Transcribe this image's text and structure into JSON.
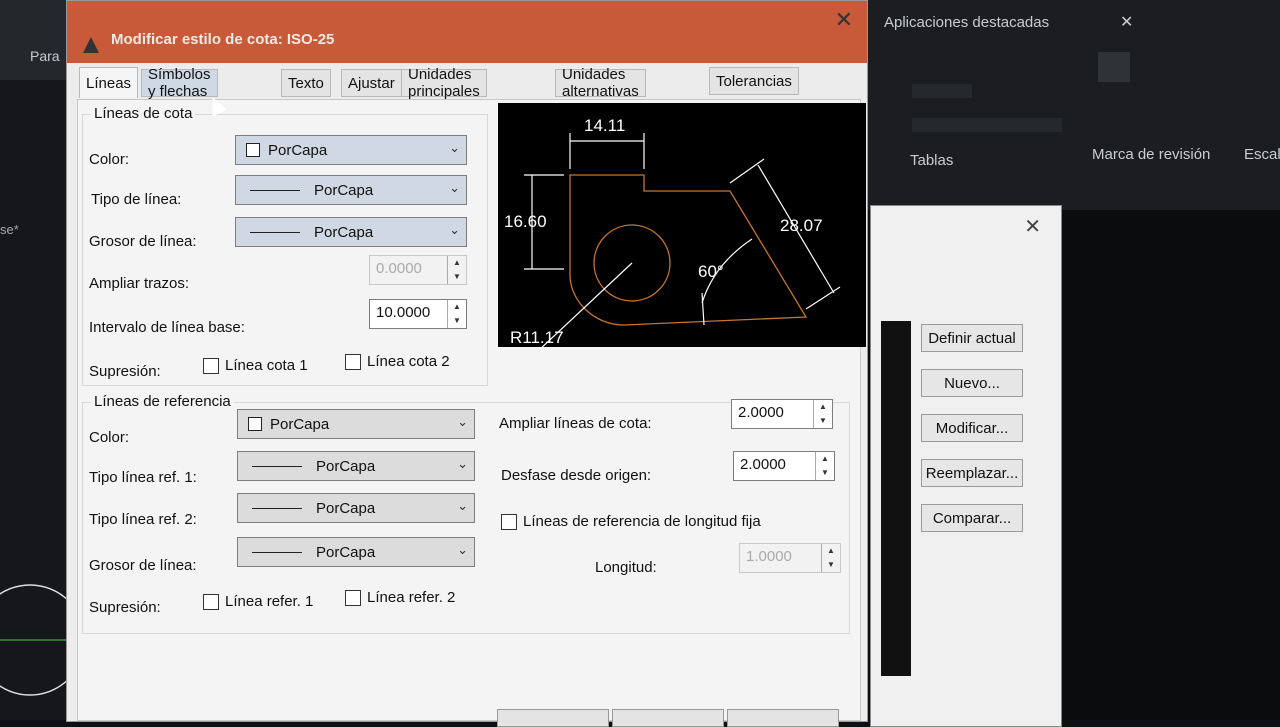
{
  "background": {
    "top_left_text": "Para",
    "ribbon_title": "Aplicaciones destacadas",
    "tables_label": "Tablas",
    "revision_label": "Marca de revisión",
    "scale_label": "Escal",
    "tab_fragment": "se*"
  },
  "secondary_dialog": {
    "buttons": [
      "Definir actual",
      "Nuevo...",
      "Modificar...",
      "Reemplazar...",
      "Comparar..."
    ]
  },
  "dialog": {
    "title": "Modificar estilo de cota: ISO-25",
    "tabs": [
      "Líneas",
      "Símbolos y flechas",
      "Texto",
      "Ajustar",
      "Unidades principales",
      "Unidades alternativas",
      "Tolerancias"
    ],
    "active_tab": "Líneas",
    "dim_lines": {
      "title": "Líneas de cota",
      "color_label": "Color:",
      "color_value": "PorCapa",
      "linetype_label": "Tipo de línea:",
      "linetype_value": "PorCapa",
      "lineweight_label": "Grosor de línea:",
      "lineweight_value": "PorCapa",
      "extend_label": "Ampliar trazos:",
      "extend_value": "0.0000",
      "baseline_label": "Intervalo de línea base:",
      "baseline_value": "10.0000",
      "suppress_label": "Supresión:",
      "suppress_1": "Línea cota 1",
      "suppress_2": "Línea cota 2"
    },
    "ext_lines": {
      "title": "Líneas de referencia",
      "color_label": "Color:",
      "color_value": "PorCapa",
      "linetype1_label": "Tipo línea ref. 1:",
      "linetype1_value": "PorCapa",
      "linetype2_label": "Tipo línea ref. 2:",
      "linetype2_value": "PorCapa",
      "lineweight_label": "Grosor de línea:",
      "lineweight_value": "PorCapa",
      "suppress_label": "Supresión:",
      "suppress_1": "Línea refer. 1",
      "suppress_2": "Línea refer. 2"
    },
    "right": {
      "extend_label": "Ampliar líneas de cota:",
      "extend_value": "2.0000",
      "offset_label": "Desfase desde origen:",
      "offset_value": "2.0000",
      "fixed_label": "Líneas de referencia de longitud fija",
      "length_label": "Longitud:",
      "length_value": "1.0000"
    },
    "preview": {
      "dim_top": "14.11",
      "dim_left": "16.60",
      "dim_right": "28.07",
      "dim_angle": "60°",
      "dim_radius": "R11.17"
    }
  }
}
